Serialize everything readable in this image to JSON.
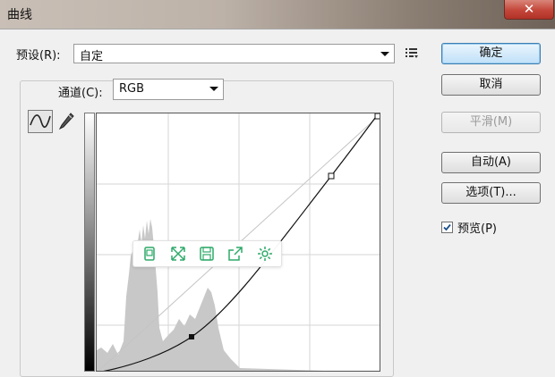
{
  "window": {
    "title": "曲线",
    "close_glyph": "✕"
  },
  "preset": {
    "label": "预设(R):",
    "value": "自定"
  },
  "channel": {
    "label": "通道(C):",
    "value": "RGB"
  },
  "buttons": {
    "ok": "确定",
    "cancel": "取消",
    "smooth": "平滑(M)",
    "auto": "自动(A)",
    "options": "选项(T)..."
  },
  "preview": {
    "label": "预览(P)",
    "checked": true
  },
  "floating_toolbar": {
    "items": [
      "copy-icon",
      "fullscreen-icon",
      "save-icon",
      "share-icon",
      "settings-icon"
    ],
    "color": "#2eaa6a"
  },
  "colors": {
    "primary_border": "#3c7fb1",
    "curve": "#000000",
    "histogram": "#c8c8c8"
  }
}
